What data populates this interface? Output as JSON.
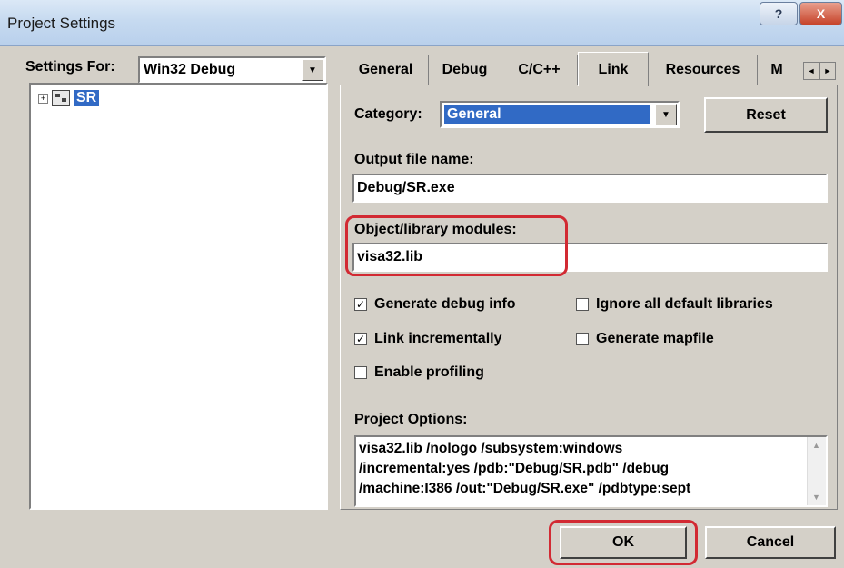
{
  "window": {
    "title": "Project Settings",
    "help_glyph": "?",
    "close_glyph": "X"
  },
  "left": {
    "settings_for_label": "Settings For:",
    "config_value": "Win32 Debug",
    "tree_expander": "+",
    "tree_project": "SR"
  },
  "tabs": [
    {
      "label": "General"
    },
    {
      "label": "Debug"
    },
    {
      "label": "C/C++"
    },
    {
      "label": "Link"
    },
    {
      "label": "Resources"
    },
    {
      "label": "M"
    }
  ],
  "link_page": {
    "category_label": "Category:",
    "category_value": "General",
    "reset_label": "Reset",
    "output_label": "Output file name:",
    "output_value": "Debug/SR.exe",
    "modules_label": "Object/library modules:",
    "modules_value": "visa32.lib",
    "checkboxes": [
      {
        "label": "Generate debug info",
        "checked": true,
        "mark": "✓"
      },
      {
        "label": "Ignore all default libraries",
        "checked": false,
        "mark": ""
      },
      {
        "label": "Link incrementally",
        "checked": true,
        "mark": "✓"
      },
      {
        "label": "Generate mapfile",
        "checked": false,
        "mark": ""
      },
      {
        "label": "Enable profiling",
        "checked": false,
        "mark": ""
      }
    ],
    "options_label": "Project Options:",
    "options_value": "visa32.lib /nologo /subsystem:windows\n/incremental:yes /pdb:\"Debug/SR.pdb\" /debug\n/machine:I386 /out:\"Debug/SR.exe\" /pdbtype:sept"
  },
  "footer": {
    "ok_label": "OK",
    "cancel_label": "Cancel"
  },
  "colors": {
    "highlight": "#d22a33",
    "selection": "#316ac5"
  }
}
